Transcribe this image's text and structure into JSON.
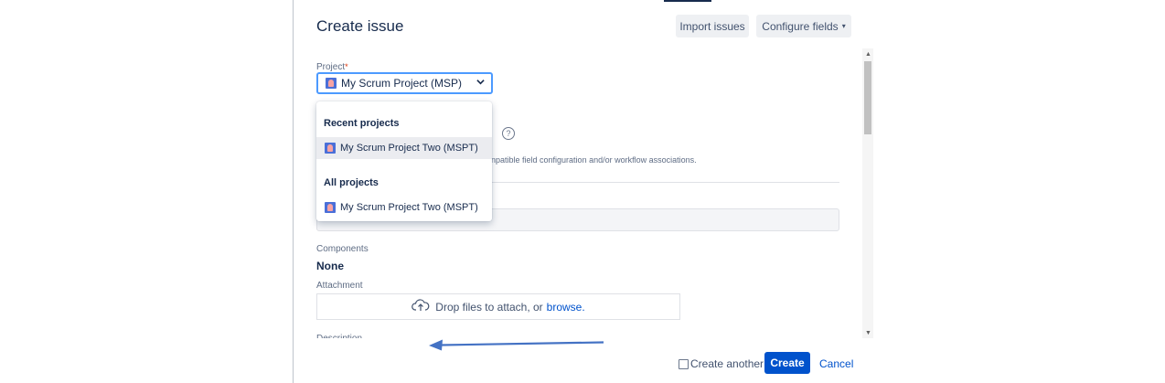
{
  "dialog": {
    "title": "Create issue",
    "import_label": "Import issues",
    "configure_label": "Configure fields"
  },
  "form": {
    "project_label": "Project",
    "required_mark": "*",
    "project_value": "My Scrum Project  (MSP)",
    "help_glyph": "?",
    "faded_text": "npatible field configuration and/or workflow associations.",
    "components_label": "Components",
    "components_value": "None",
    "attachment_label": "Attachment",
    "drop_text": "Drop files to attach, or",
    "browse_link": "browse.",
    "description_label": "Description"
  },
  "dropdown": {
    "recent_header": "Recent projects",
    "recent_items": [
      "My Scrum Project Two (MSPT)"
    ],
    "all_header": "All projects",
    "all_items": [
      "My Scrum Project Two (MSPT)"
    ]
  },
  "footer": {
    "create_another_label": "Create another",
    "create_button": "Create",
    "cancel_link": "Cancel"
  },
  "icons": [
    "project-avatar-icon",
    "chevron-down-icon",
    "help-icon",
    "cloud-upload-icon",
    "arrow-left-icon",
    "scroll-up-icon",
    "scroll-down-icon"
  ],
  "colors": {
    "primary": "#0052cc",
    "focus": "#4c9aff",
    "annotation_arrow": "#4472c4",
    "required": "#de350b"
  }
}
